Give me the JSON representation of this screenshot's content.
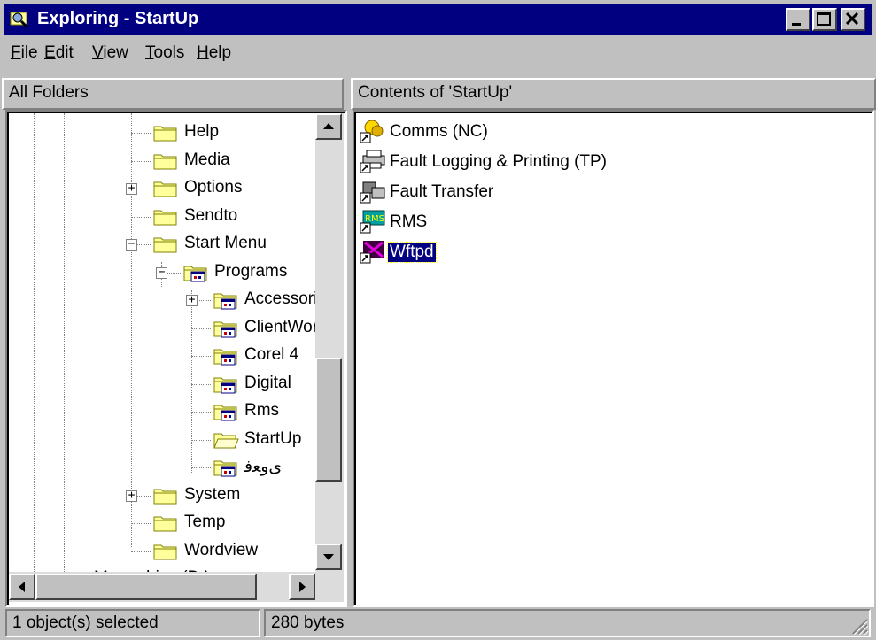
{
  "window": {
    "title": "Exploring - StartUp"
  },
  "menu": [
    {
      "key": "F",
      "rest": "ile"
    },
    {
      "key": "E",
      "rest": "dit"
    },
    {
      "key": "V",
      "rest": "iew"
    },
    {
      "key": "T",
      "rest": "ools"
    },
    {
      "key": "H",
      "rest": "elp"
    }
  ],
  "left_header": "All Folders",
  "right_header": "Contents of 'StartUp'",
  "tree": [
    {
      "label": "Help",
      "level": 0,
      "expander": "",
      "open": false,
      "type": "folder"
    },
    {
      "label": "Media",
      "level": 0,
      "expander": "",
      "open": false,
      "type": "folder"
    },
    {
      "label": "Options",
      "level": 0,
      "expander": "+",
      "open": false,
      "type": "folder"
    },
    {
      "label": "Sendto",
      "level": 0,
      "expander": "",
      "open": false,
      "type": "folder"
    },
    {
      "label": "Start Menu",
      "level": 0,
      "expander": "−",
      "open": false,
      "type": "folder"
    },
    {
      "label": "Programs",
      "level": 1,
      "expander": "−",
      "open": false,
      "type": "progfolder"
    },
    {
      "label": "Accessories",
      "level": 2,
      "expander": "+",
      "open": false,
      "type": "progfolder"
    },
    {
      "label": "ClientWorks",
      "level": 2,
      "expander": "",
      "open": false,
      "type": "progfolder"
    },
    {
      "label": "Corel 4",
      "level": 2,
      "expander": "",
      "open": false,
      "type": "progfolder"
    },
    {
      "label": "Digital",
      "level": 2,
      "expander": "",
      "open": false,
      "type": "progfolder"
    },
    {
      "label": "Rms",
      "level": 2,
      "expander": "",
      "open": false,
      "type": "progfolder"
    },
    {
      "label": "StartUp",
      "level": 2,
      "expander": "",
      "open": true,
      "type": "openfolder"
    },
    {
      "label": "ﻯﻭﻌﻓ",
      "level": 2,
      "expander": "",
      "open": false,
      "type": "progfolder"
    },
    {
      "label": "System",
      "level": 0,
      "expander": "+",
      "open": false,
      "type": "folder"
    },
    {
      "label": "Temp",
      "level": 0,
      "expander": "",
      "open": false,
      "type": "folder"
    },
    {
      "label": "Wordview",
      "level": 0,
      "expander": "",
      "open": false,
      "type": "folder"
    },
    {
      "label": "Mayordrive (D:)",
      "level": -3,
      "expander": "+",
      "open": false,
      "type": "drive"
    }
  ],
  "files": [
    {
      "label": "Comms (NC)",
      "icon": "comms-shortcut-icon",
      "selected": false
    },
    {
      "label": "Fault Logging & Printing (TP)",
      "icon": "printer-shortcut-icon",
      "selected": false
    },
    {
      "label": "Fault Transfer",
      "icon": "transfer-shortcut-icon",
      "selected": false
    },
    {
      "label": "RMS",
      "icon": "rms-shortcut-icon",
      "selected": false
    },
    {
      "label": "Wftpd",
      "icon": "wftpd-shortcut-icon",
      "selected": true
    }
  ],
  "status": {
    "selection": "1 object(s) selected",
    "size": "280 bytes"
  },
  "colors": {
    "titlebar": "#000080",
    "face": "#c0c0c0",
    "selection": "#000080",
    "folder": "#ffff9c"
  }
}
